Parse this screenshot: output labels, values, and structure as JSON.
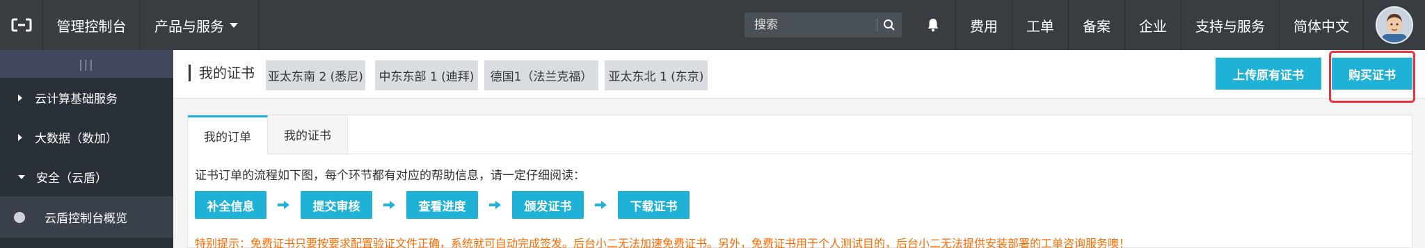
{
  "topbar": {
    "console_label": "管理控制台",
    "products_label": "产品与服务",
    "search_placeholder": "搜索",
    "nav": [
      "费用",
      "工单",
      "备案",
      "企业",
      "支持与服务",
      "简体中文"
    ]
  },
  "sidebar": {
    "toggle_label": "|||",
    "items": [
      {
        "label": "云计算基础服务"
      },
      {
        "label": "大数据（数加）"
      },
      {
        "label": "安全（云盾）"
      }
    ],
    "sub_item": "云盾控制台概览"
  },
  "header": {
    "title": "我的证书",
    "regions": [
      "亚太东南 2 (悉尼)",
      "中东东部 1 (迪拜)",
      "德国1（法兰克福）",
      "亚太东北 1 (东京)"
    ],
    "upload_button": "上传原有证书",
    "buy_button": "购买证书"
  },
  "panel": {
    "tabs": [
      "我的订单",
      "我的证书"
    ],
    "intro": "证书订单的流程如下图，每个环节都有对应的帮助信息，请一定仔细阅读：",
    "steps": [
      "补全信息",
      "提交审核",
      "查看进度",
      "颁发证书",
      "下载证书"
    ],
    "warning": "特别提示：免费证书只要按要求配置验证文件正确，系统就可自动完成签发。后台小二无法加速免费证书。另外，免费证书用于个人测试目的，后台小二无法提供安装部署的工单咨询服务噢！"
  },
  "colors": {
    "topbar": "#373d41",
    "sidebar": "#293038",
    "accent": "#1fb1d6",
    "warning": "#ff6a00",
    "highlight": "#e8323e"
  },
  "icons": {
    "logo": "aliyun-logo-icon",
    "search": "search-icon",
    "bell": "bell-icon",
    "avatar": "user-avatar"
  }
}
